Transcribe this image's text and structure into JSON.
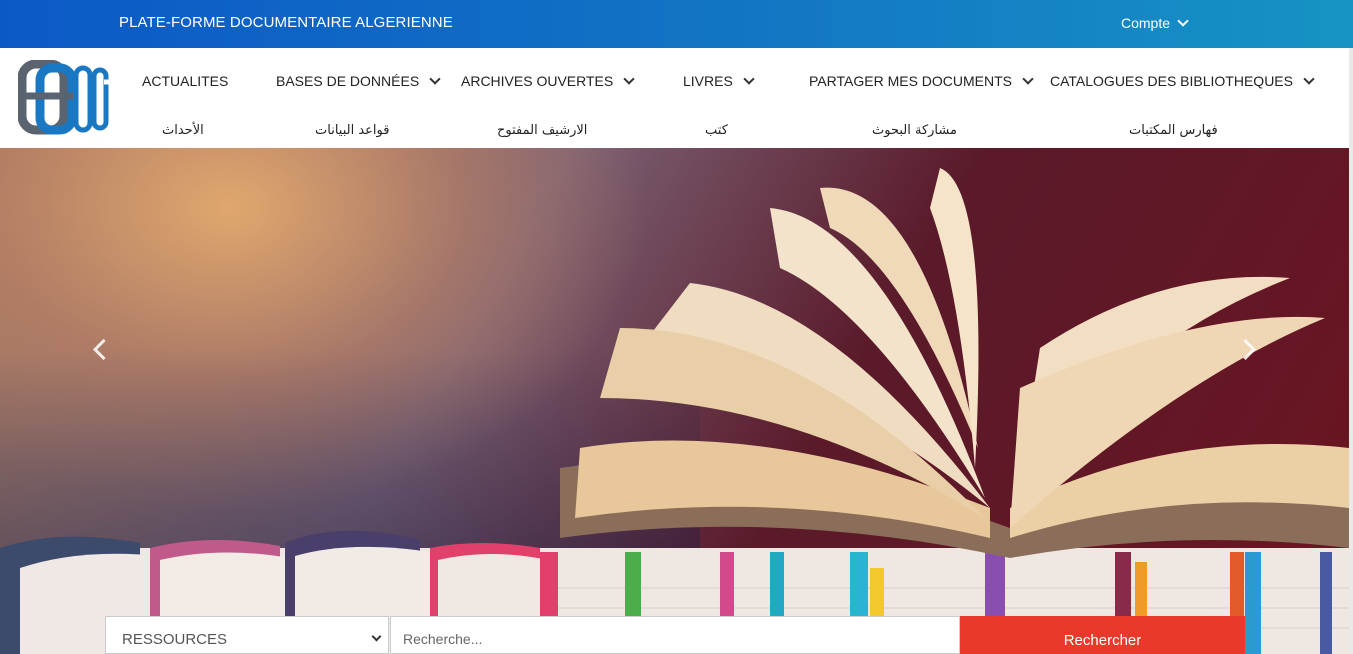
{
  "topbar": {
    "site_title": "PLATE-FORME DOCUMENTAIRE ALGERIENNE",
    "account_label": "Compte"
  },
  "nav": {
    "items": [
      {
        "label": "ACTUALITES",
        "label_ar": "الأحداث",
        "has_dropdown": false
      },
      {
        "label": "BASES DE DONNÉES",
        "label_ar": "قواعد البيانات",
        "has_dropdown": true
      },
      {
        "label": "ARCHIVES OUVERTES",
        "label_ar": "الارشيف المفتوح",
        "has_dropdown": true
      },
      {
        "label": "LIVRES",
        "label_ar": "كتب",
        "has_dropdown": true
      },
      {
        "label": "PARTAGER MES DOCUMENTS",
        "label_ar": "مشاركة البحوث",
        "has_dropdown": true
      },
      {
        "label": "CATALOGUES DES BIBLIOTHEQUES",
        "label_ar": "فهارس المكتبات",
        "has_dropdown": true
      }
    ]
  },
  "search": {
    "select_value": "RESSOURCES",
    "placeholder": "Recherche...",
    "button_label": "Rechercher"
  },
  "colors": {
    "topbar_start": "#0b59c6",
    "topbar_end": "#1693c4",
    "search_button": "#e8392b",
    "logo_blue": "#1a78c2",
    "logo_gray": "#5a6470"
  }
}
